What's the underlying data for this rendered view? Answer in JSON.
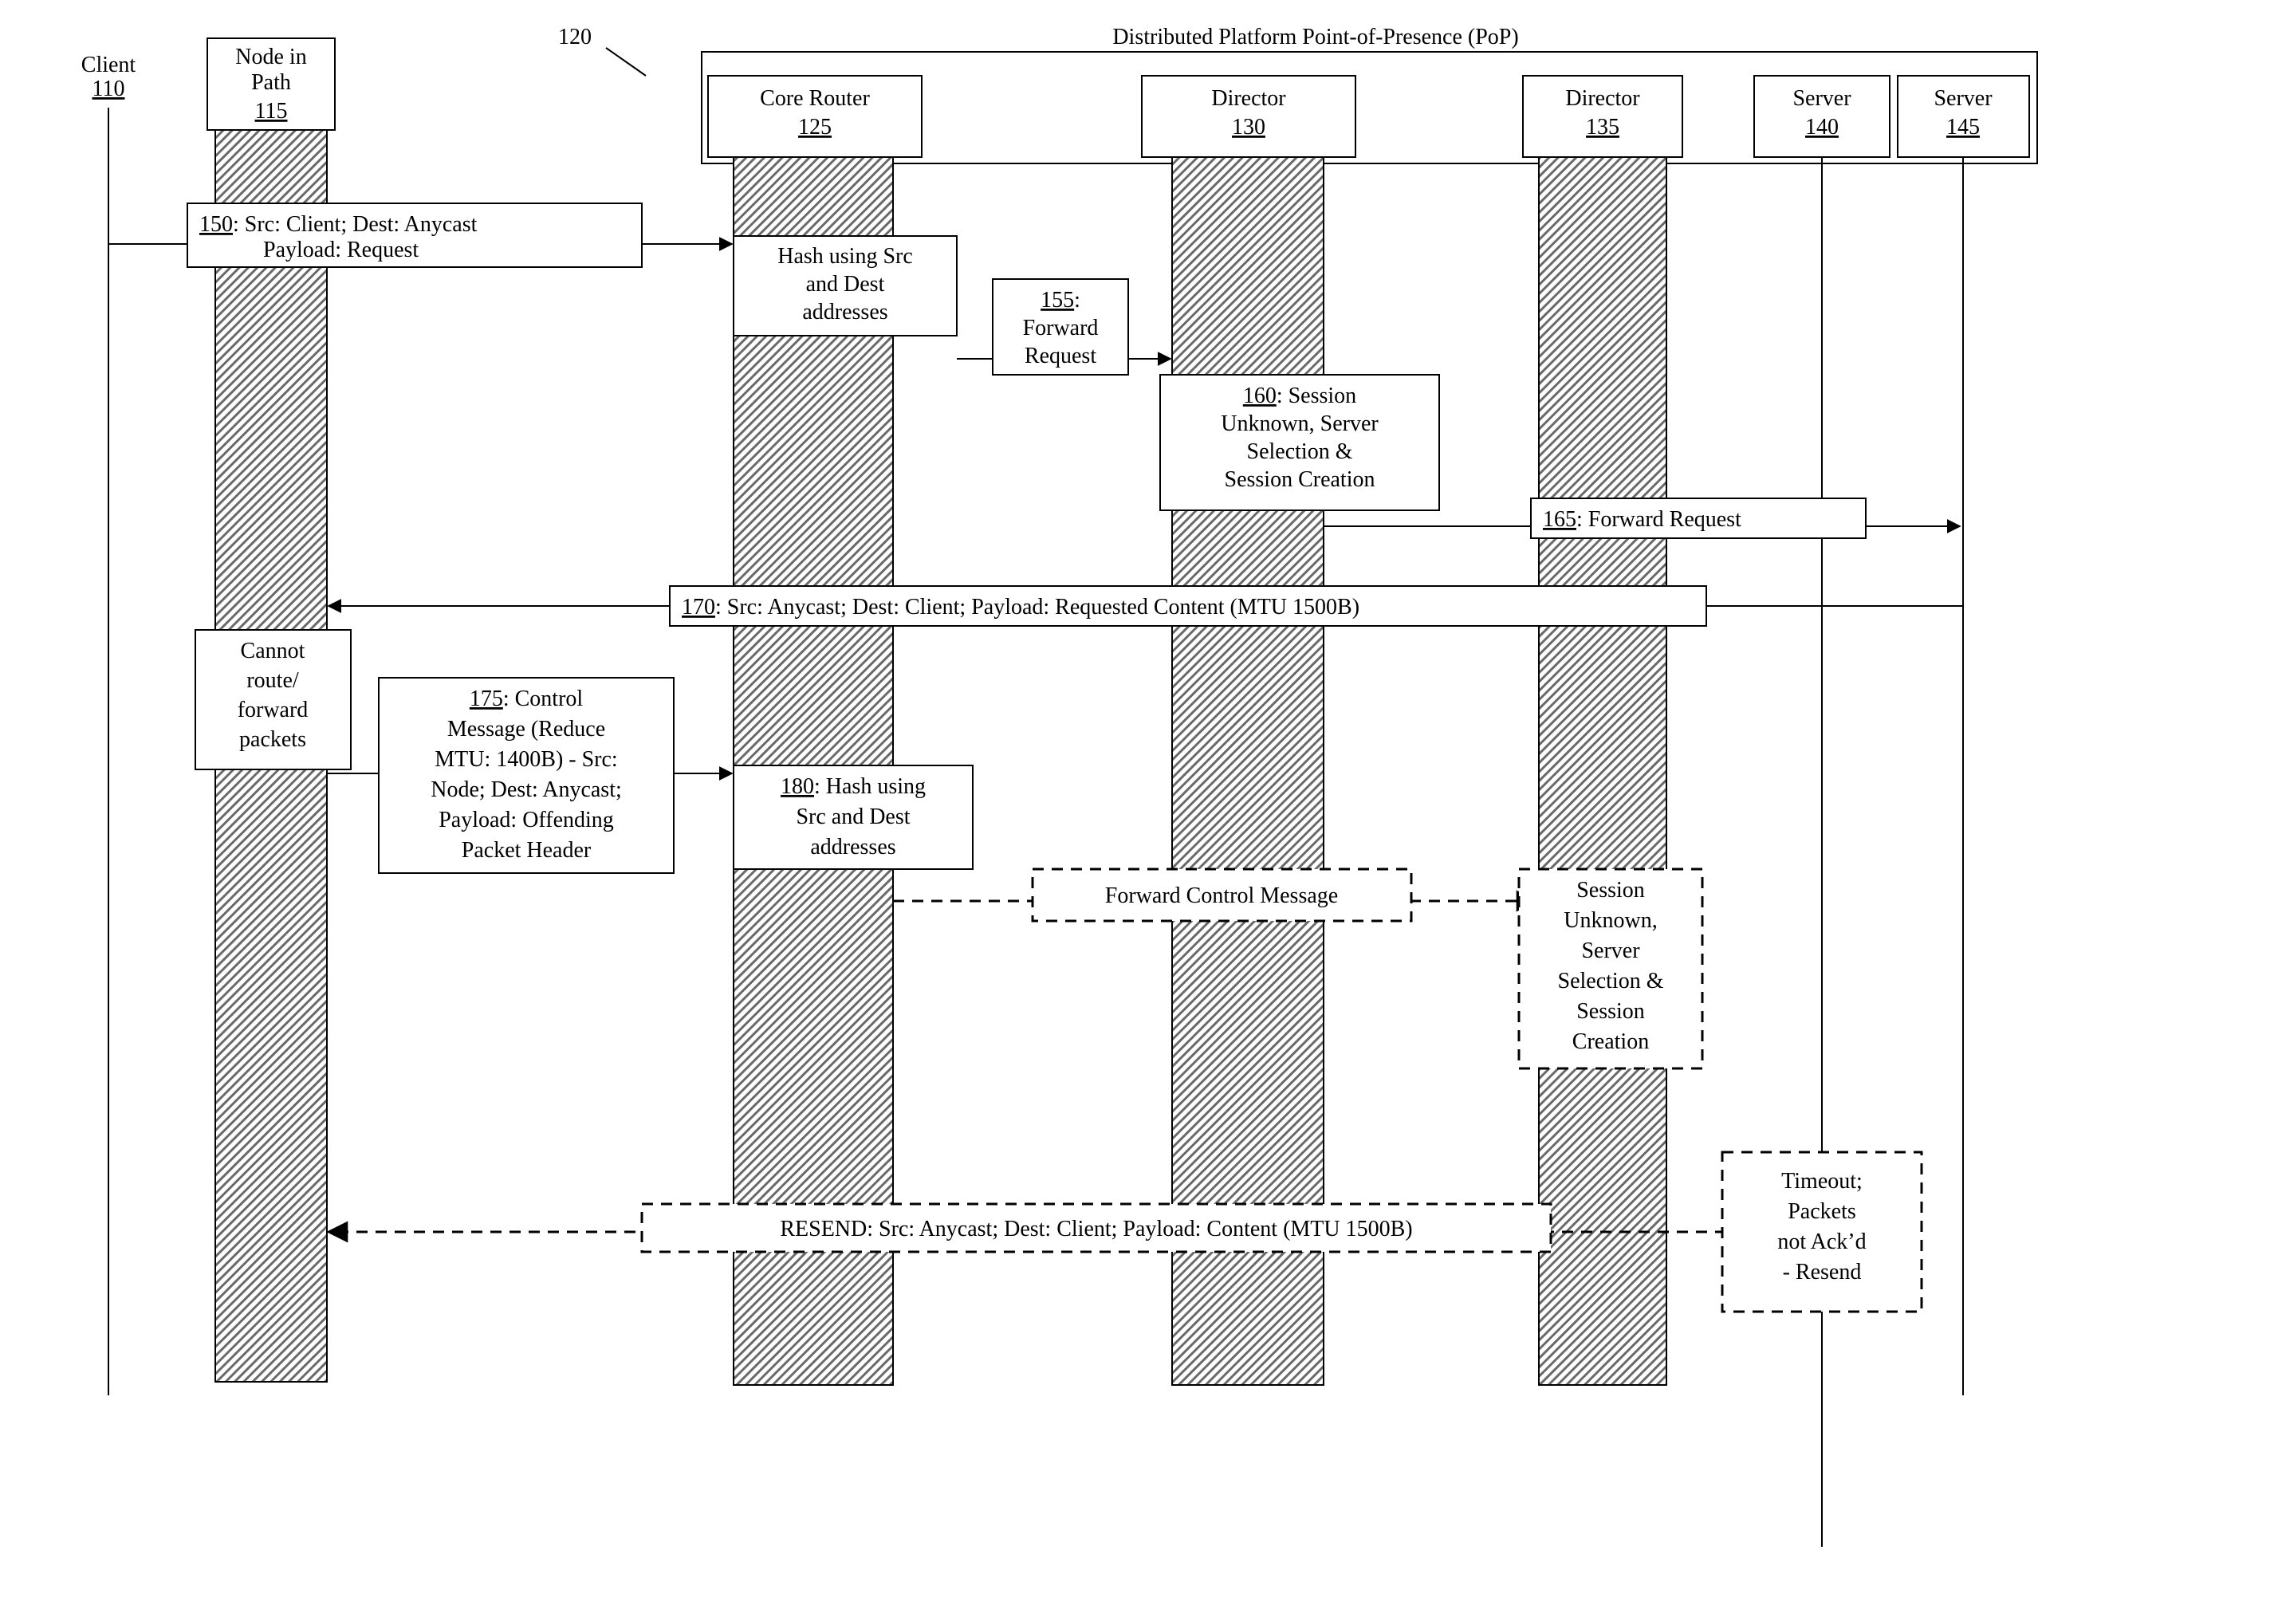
{
  "header": {
    "pop_title": "Distributed Platform Point-of-Presence (PoP)",
    "pop_leader_label": "120"
  },
  "lanes": {
    "client": {
      "label": "Client",
      "num": "110"
    },
    "node": {
      "label1": "Node in",
      "label2": "Path",
      "num": "115"
    },
    "core": {
      "label": "Core Router",
      "num": "125"
    },
    "dir1": {
      "label": "Director",
      "num": "130"
    },
    "dir2": {
      "label": "Director",
      "num": "135"
    },
    "srv1": {
      "label": "Server",
      "num": "140"
    },
    "srv2": {
      "label": "Server",
      "num": "145"
    }
  },
  "msgs": {
    "m150": {
      "num": "150",
      "l1": ": Src: Client; Dest: Anycast",
      "l2": "Payload: Request"
    },
    "hash1": {
      "l1": "Hash using Src",
      "l2": "and Dest",
      "l3": "addresses"
    },
    "m155": {
      "num": "155",
      "l1": ":",
      "l2": "Forward",
      "l3": "Request"
    },
    "m160": {
      "num": "160",
      "l1": ": Session",
      "l2": "Unknown, Server",
      "l3": "Selection &",
      "l4": "Session Creation"
    },
    "m165": {
      "num": "165",
      "l1": ": Forward Request"
    },
    "m170": {
      "num": "170",
      "l1": ": Src: Anycast; Dest: Client; Payload: Requested Content (MTU 1500B)"
    },
    "cannot": {
      "l1": "Cannot",
      "l2": "route/",
      "l3": "forward",
      "l4": "packets"
    },
    "m175": {
      "num": "175",
      "l1": ": Control",
      "l2": "Message (Reduce",
      "l3": "MTU: 1400B) - Src:",
      "l4": "Node; Dest: Anycast;",
      "l5": "Payload: Offending",
      "l6": "Packet Header"
    },
    "m180": {
      "num": "180",
      "l1": ": Hash using",
      "l2": "Src and Dest",
      "l3": "addresses"
    },
    "fwdctrl": {
      "l1": "Forward Control Message"
    },
    "sess2": {
      "l1": "Session",
      "l2": "Unknown,",
      "l3": "Server",
      "l4": "Selection &",
      "l5": "Session",
      "l6": "Creation"
    },
    "resend": {
      "l1": "RESEND: Src: Anycast; Dest: Client; Payload: Content (MTU 1500B)"
    },
    "timeout": {
      "l1": "Timeout;",
      "l2": "Packets",
      "l3": "not Ack’d",
      "l4": "- Resend"
    }
  }
}
